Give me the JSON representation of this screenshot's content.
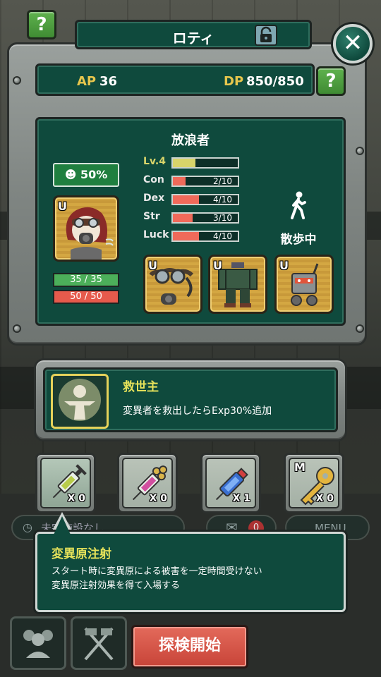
{
  "header": {
    "character_name": "ロティ"
  },
  "resources": {
    "ap_label": "AP",
    "ap_value": "36",
    "dp_label": "DP",
    "dp_value": "850/850"
  },
  "character": {
    "job": "放浪者",
    "mood": "50%",
    "portrait_badge": "U",
    "hp": {
      "text": "35 / 35",
      "fill": 1.0
    },
    "sp": {
      "text": "50 / 50",
      "fill": 1.0
    },
    "stats": [
      {
        "label": "Lv.4",
        "value": "",
        "fill": 0.35
      },
      {
        "label": "Con",
        "value": "2/10",
        "fill": 0.2
      },
      {
        "label": "Dex",
        "value": "4/10",
        "fill": 0.4
      },
      {
        "label": "Str",
        "value": "3/10",
        "fill": 0.3
      },
      {
        "label": "Luck",
        "value": "4/10",
        "fill": 0.4
      }
    ],
    "status": "散歩中",
    "equipment": [
      {
        "name": "goggles-icon",
        "badge": "U"
      },
      {
        "name": "outfit-icon",
        "badge": "U"
      },
      {
        "name": "robot-icon",
        "badge": "U"
      }
    ]
  },
  "perk": {
    "title": "救世主",
    "description": "変異者を救出したらExp30%追加"
  },
  "items": [
    {
      "icon": "mutagen-syringe-icon",
      "count": "X 0",
      "selected": true
    },
    {
      "icon": "pink-syringe-icon",
      "count": "X 0"
    },
    {
      "icon": "blue-syringe-icon",
      "count": "X 1"
    },
    {
      "icon": "key-icon",
      "count": "X 0",
      "badge": "M"
    }
  ],
  "tooltip": {
    "title": "変異原注射",
    "line1": "スタート時に変異原による被害を一定時間受けない",
    "line2": "変異原注射効果を得て入場する"
  },
  "background": {
    "facility_text": "未完施設なし",
    "menu_label": "MENU",
    "badge_count": "0"
  },
  "actions": {
    "start_label": "探検開始"
  },
  "colors": {
    "panel_green": "#0f4a3d",
    "accent_yellow": "#e6e25a",
    "stat_red": "#f06a5a",
    "start_red": "#d5584a"
  }
}
